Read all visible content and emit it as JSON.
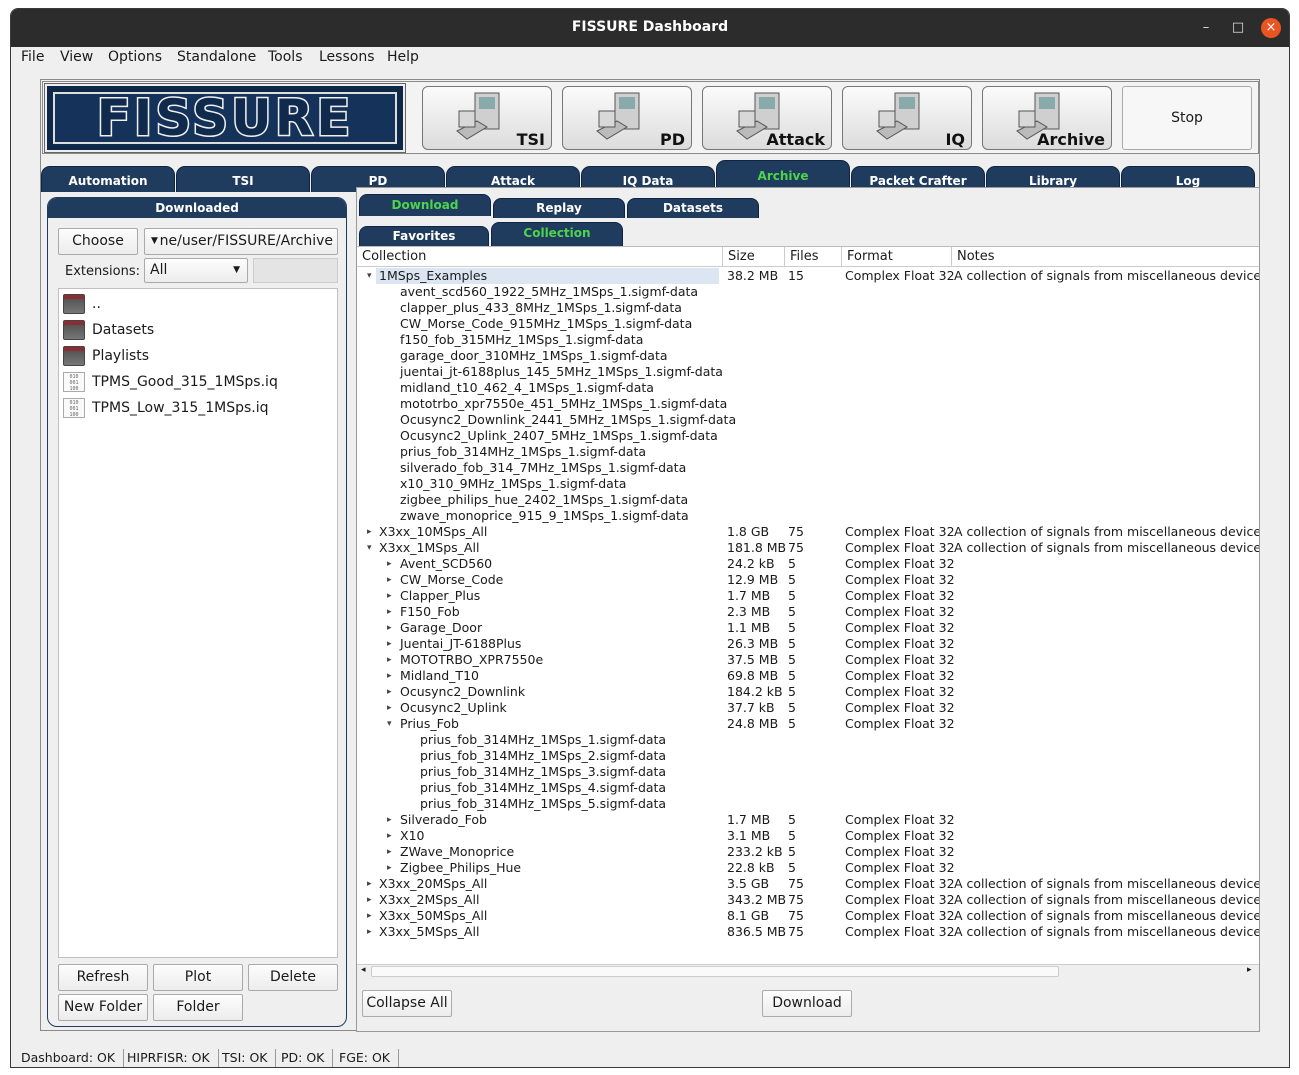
{
  "window": {
    "title": "FISSURE Dashboard",
    "minimize": "–",
    "maximize": "□",
    "close": "×"
  },
  "menu": [
    "File",
    "View",
    "Options",
    "Standalone",
    "Tools",
    "Lessons",
    "Help"
  ],
  "toolbar": {
    "logo_text": "FISSURE",
    "buttons": [
      "TSI",
      "PD",
      "Attack",
      "IQ",
      "Archive"
    ],
    "stop": "Stop"
  },
  "main_tabs": [
    "Automation",
    "TSI",
    "PD",
    "Attack",
    "IQ Data",
    "Archive",
    "Packet Crafter",
    "Library",
    "Log"
  ],
  "main_tab_active": "Archive",
  "left": {
    "header": "Downloaded",
    "choose": "Choose",
    "path": "ne/user/FISSURE/Archive",
    "extensions_label": "Extensions:",
    "extensions_value": "All",
    "files": [
      {
        "name": "..",
        "type": "folder"
      },
      {
        "name": "Datasets",
        "type": "folder"
      },
      {
        "name": "Playlists",
        "type": "folder"
      },
      {
        "name": "TPMS_Good_315_1MSps.iq",
        "type": "file"
      },
      {
        "name": "TPMS_Low_315_1MSps.iq",
        "type": "file"
      }
    ],
    "buttons": {
      "refresh": "Refresh",
      "plot": "Plot",
      "delete": "Delete",
      "new_folder": "New Folder",
      "folder": "Folder"
    }
  },
  "sub_tabs_row1": [
    "Download",
    "Replay",
    "Datasets"
  ],
  "sub_tabs_row2": [
    "Favorites",
    "Collection"
  ],
  "sub_active": [
    "Download",
    "Collection"
  ],
  "tree": {
    "columns": [
      "Collection",
      "Size",
      "Files",
      "Format",
      "Notes"
    ],
    "rows": [
      {
        "d": 0,
        "a": "open",
        "name": "1MSps_Examples",
        "size": "38.2 MB",
        "files": "15",
        "format": "Complex Float 32",
        "notes": "A collection of signals from miscellaneous devices re"
      },
      {
        "d": 1,
        "a": "",
        "name": "avent_scd560_1922_5MHz_1MSps_1.sigmf-data"
      },
      {
        "d": 1,
        "a": "",
        "name": "clapper_plus_433_8MHz_1MSps_1.sigmf-data"
      },
      {
        "d": 1,
        "a": "",
        "name": "CW_Morse_Code_915MHz_1MSps_1.sigmf-data"
      },
      {
        "d": 1,
        "a": "",
        "name": "f150_fob_315MHz_1MSps_1.sigmf-data"
      },
      {
        "d": 1,
        "a": "",
        "name": "garage_door_310MHz_1MSps_1.sigmf-data"
      },
      {
        "d": 1,
        "a": "",
        "name": "juentai_jt-6188plus_145_5MHz_1MSps_1.sigmf-data"
      },
      {
        "d": 1,
        "a": "",
        "name": "midland_t10_462_4_1MSps_1.sigmf-data"
      },
      {
        "d": 1,
        "a": "",
        "name": "mototrbo_xpr7550e_451_5MHz_1MSps_1.sigmf-data"
      },
      {
        "d": 1,
        "a": "",
        "name": "Ocusync2_Downlink_2441_5MHz_1MSps_1.sigmf-data"
      },
      {
        "d": 1,
        "a": "",
        "name": "Ocusync2_Uplink_2407_5MHz_1MSps_1.sigmf-data"
      },
      {
        "d": 1,
        "a": "",
        "name": "prius_fob_314MHz_1MSps_1.sigmf-data"
      },
      {
        "d": 1,
        "a": "",
        "name": "silverado_fob_314_7MHz_1MSps_1.sigmf-data"
      },
      {
        "d": 1,
        "a": "",
        "name": "x10_310_9MHz_1MSps_1.sigmf-data"
      },
      {
        "d": 1,
        "a": "",
        "name": "zigbee_philips_hue_2402_1MSps_1.sigmf-data"
      },
      {
        "d": 1,
        "a": "",
        "name": "zwave_monoprice_915_9_1MSps_1.sigmf-data"
      },
      {
        "d": 0,
        "a": "closed",
        "name": "X3xx_10MSps_All",
        "size": "1.8 GB",
        "files": "75",
        "format": "Complex Float 32",
        "notes": "A collection of signals from miscellaneous devices re"
      },
      {
        "d": 0,
        "a": "open",
        "name": "X3xx_1MSps_All",
        "size": "181.8 MB",
        "files": "75",
        "format": "Complex Float 32",
        "notes": "A collection of signals from miscellaneous devices re"
      },
      {
        "d": 1,
        "a": "closed",
        "name": "Avent_SCD560",
        "size": "24.2 kB",
        "files": "5",
        "format": "Complex Float 32"
      },
      {
        "d": 1,
        "a": "closed",
        "name": "CW_Morse_Code",
        "size": "12.9 MB",
        "files": "5",
        "format": "Complex Float 32"
      },
      {
        "d": 1,
        "a": "closed",
        "name": "Clapper_Plus",
        "size": "1.7 MB",
        "files": "5",
        "format": "Complex Float 32"
      },
      {
        "d": 1,
        "a": "closed",
        "name": "F150_Fob",
        "size": "2.3 MB",
        "files": "5",
        "format": "Complex Float 32"
      },
      {
        "d": 1,
        "a": "closed",
        "name": "Garage_Door",
        "size": "1.1 MB",
        "files": "5",
        "format": "Complex Float 32"
      },
      {
        "d": 1,
        "a": "closed",
        "name": "Juentai_JT-6188Plus",
        "size": "26.3 MB",
        "files": "5",
        "format": "Complex Float 32"
      },
      {
        "d": 1,
        "a": "closed",
        "name": "MOTOTRBO_XPR7550e",
        "size": "37.5 MB",
        "files": "5",
        "format": "Complex Float 32"
      },
      {
        "d": 1,
        "a": "closed",
        "name": "Midland_T10",
        "size": "69.8 MB",
        "files": "5",
        "format": "Complex Float 32"
      },
      {
        "d": 1,
        "a": "closed",
        "name": "Ocusync2_Downlink",
        "size": "184.2 kB",
        "files": "5",
        "format": "Complex Float 32"
      },
      {
        "d": 1,
        "a": "closed",
        "name": "Ocusync2_Uplink",
        "size": "37.7 kB",
        "files": "5",
        "format": "Complex Float 32"
      },
      {
        "d": 1,
        "a": "open",
        "name": "Prius_Fob",
        "size": "24.8 MB",
        "files": "5",
        "format": "Complex Float 32"
      },
      {
        "d": 2,
        "a": "",
        "name": "prius_fob_314MHz_1MSps_1.sigmf-data"
      },
      {
        "d": 2,
        "a": "",
        "name": "prius_fob_314MHz_1MSps_2.sigmf-data"
      },
      {
        "d": 2,
        "a": "",
        "name": "prius_fob_314MHz_1MSps_3.sigmf-data"
      },
      {
        "d": 2,
        "a": "",
        "name": "prius_fob_314MHz_1MSps_4.sigmf-data"
      },
      {
        "d": 2,
        "a": "",
        "name": "prius_fob_314MHz_1MSps_5.sigmf-data"
      },
      {
        "d": 1,
        "a": "closed",
        "name": "Silverado_Fob",
        "size": "1.7 MB",
        "files": "5",
        "format": "Complex Float 32"
      },
      {
        "d": 1,
        "a": "closed",
        "name": "X10",
        "size": "3.1 MB",
        "files": "5",
        "format": "Complex Float 32"
      },
      {
        "d": 1,
        "a": "closed",
        "name": "ZWave_Monoprice",
        "size": "233.2 kB",
        "files": "5",
        "format": "Complex Float 32"
      },
      {
        "d": 1,
        "a": "closed",
        "name": "Zigbee_Philips_Hue",
        "size": "22.8 kB",
        "files": "5",
        "format": "Complex Float 32"
      },
      {
        "d": 0,
        "a": "closed",
        "name": "X3xx_20MSps_All",
        "size": "3.5 GB",
        "files": "75",
        "format": "Complex Float 32",
        "notes": "A collection of signals from miscellaneous devices re"
      },
      {
        "d": 0,
        "a": "closed",
        "name": "X3xx_2MSps_All",
        "size": "343.2 MB",
        "files": "75",
        "format": "Complex Float 32",
        "notes": "A collection of signals from miscellaneous devices re"
      },
      {
        "d": 0,
        "a": "closed",
        "name": "X3xx_50MSps_All",
        "size": "8.1 GB",
        "files": "75",
        "format": "Complex Float 32",
        "notes": "A collection of signals from miscellaneous devices re"
      },
      {
        "d": 0,
        "a": "closed",
        "name": "X3xx_5MSps_All",
        "size": "836.5 MB",
        "files": "75",
        "format": "Complex Float 32",
        "notes": "A collection of signals from miscellaneous devices re"
      }
    ]
  },
  "bottom": {
    "collapse_all": "Collapse All",
    "download": "Download"
  },
  "status": [
    "Dashboard: OK",
    "HIPRFISR: OK",
    "TSI: OK",
    "PD: OK",
    "FGE: OK"
  ],
  "colors": {
    "tab_bg": "#1f3b5e",
    "tab_active_text": "#4cd44c",
    "close_btn": "#e95420"
  }
}
